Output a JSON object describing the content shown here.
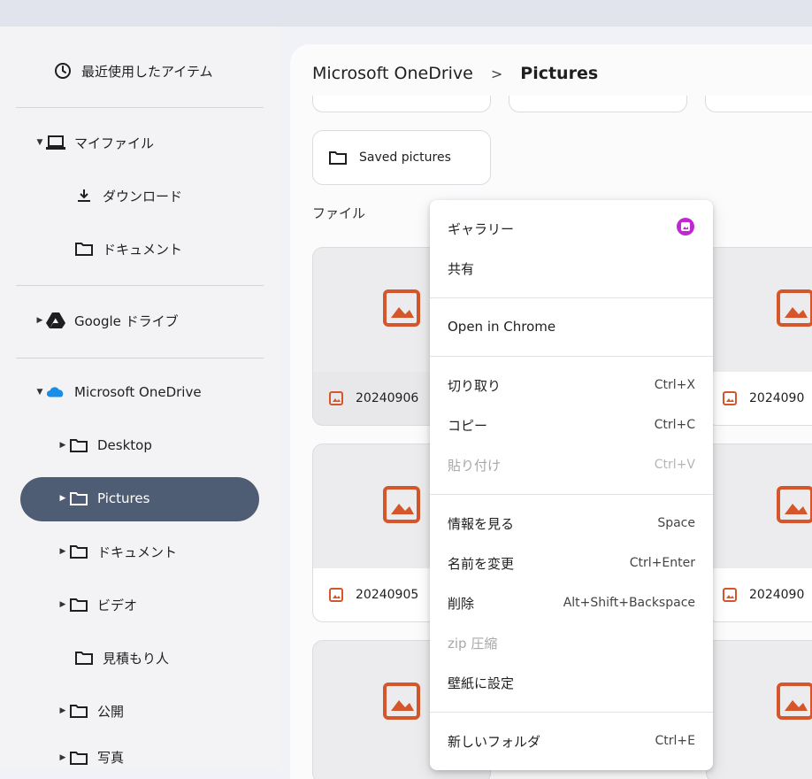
{
  "sidebar": {
    "recent": "最近使用したアイテム",
    "my_files": "マイファイル",
    "downloads": "ダウンロード",
    "documents": "ドキュメント",
    "google_drive": "Google ドライブ",
    "onedrive": "Microsoft OneDrive",
    "od_items": [
      "Desktop",
      "Pictures",
      "ドキュメント",
      "ビデオ",
      "見積もり人",
      "公開",
      "写真"
    ],
    "selected": "Pictures"
  },
  "breadcrumb": {
    "root": "Microsoft OneDrive",
    "separator": ">",
    "current": "Pictures"
  },
  "folders": [
    {
      "label": "Saved pictures"
    }
  ],
  "files_header": "ファイル",
  "files": [
    {
      "name": "20240906",
      "selected": true
    },
    {
      "name": "2024090"
    },
    {
      "name": "20240905"
    },
    {
      "name": "2024090"
    }
  ],
  "context_menu": {
    "items": [
      {
        "label": "ギャラリー",
        "shortcut": ""
      },
      {
        "label": "共有",
        "shortcut": ""
      },
      {
        "label": "Open in Chrome",
        "shortcut": ""
      },
      {
        "label": "切り取り",
        "shortcut": "Ctrl+X"
      },
      {
        "label": "コピー",
        "shortcut": "Ctrl+C"
      },
      {
        "label": "貼り付け",
        "shortcut": "Ctrl+V",
        "disabled": true
      },
      {
        "label": "情報を見る",
        "shortcut": "Space"
      },
      {
        "label": "名前を変更",
        "shortcut": "Ctrl+Enter"
      },
      {
        "label": "削除",
        "shortcut": "Alt+Shift+Backspace"
      },
      {
        "label": "zip 圧縮",
        "shortcut": "",
        "disabled": true
      },
      {
        "label": "壁紙に設定",
        "shortcut": ""
      },
      {
        "label": "新しいフォルダ",
        "shortcut": "Ctrl+E"
      }
    ]
  },
  "colors": {
    "accent_selected": "#4f5d74",
    "image_icon": "#d4562a",
    "gallery_icon": "#c026d3"
  }
}
